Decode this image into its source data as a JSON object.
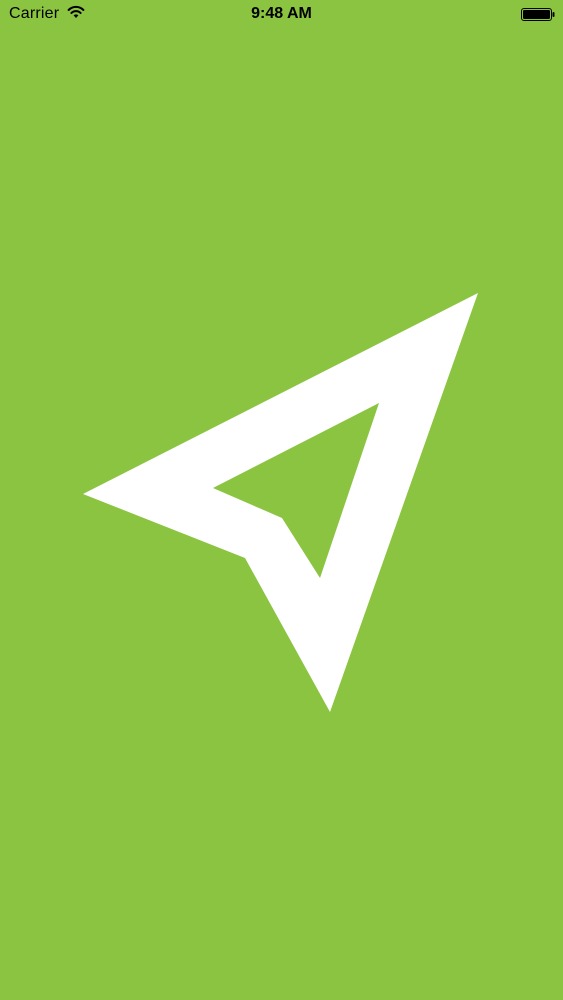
{
  "status_bar": {
    "carrier": "Carrier",
    "time": "9:48 AM",
    "wifi_icon": "wifi-icon",
    "battery_icon": "battery-icon"
  },
  "splash": {
    "background_color": "#8bc441",
    "logo_color": "#ffffff",
    "logo_icon": "navigation-arrow-icon"
  }
}
